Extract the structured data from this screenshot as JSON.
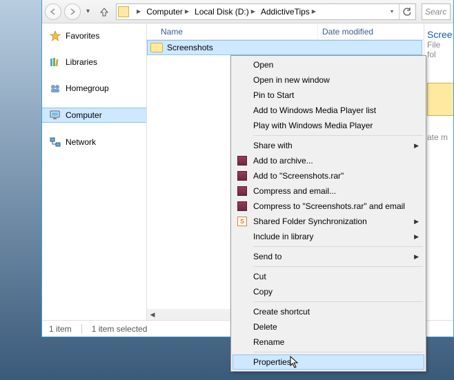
{
  "breadcrumbs": [
    "Computer",
    "Local Disk (D:)",
    "AddictiveTips"
  ],
  "search_placeholder": "Searc",
  "sidebar": {
    "items": [
      {
        "label": "Favorites"
      },
      {
        "label": "Libraries"
      },
      {
        "label": "Homegroup"
      },
      {
        "label": "Computer"
      },
      {
        "label": "Network"
      }
    ]
  },
  "columns": {
    "name": "Name",
    "date": "Date modified"
  },
  "file": {
    "name": "Screenshots"
  },
  "preview": {
    "title": "Scree",
    "type": "File fol",
    "date_prefix": "ate m"
  },
  "status": {
    "count": "1 item",
    "selected": "1 item selected"
  },
  "context": {
    "groups": [
      [
        {
          "label": "Open"
        },
        {
          "label": "Open in new window"
        },
        {
          "label": "Pin to Start"
        },
        {
          "label": "Add to Windows Media Player list"
        },
        {
          "label": "Play with Windows Media Player"
        }
      ],
      [
        {
          "label": "Share with",
          "submenu": true
        },
        {
          "label": "Add to archive...",
          "icon": "rar"
        },
        {
          "label": "Add to \"Screenshots.rar\"",
          "icon": "rar"
        },
        {
          "label": "Compress and email...",
          "icon": "rar"
        },
        {
          "label": "Compress to \"Screenshots.rar\" and email",
          "icon": "rar"
        },
        {
          "label": "Shared Folder Synchronization",
          "icon": "sf",
          "submenu": true
        },
        {
          "label": "Include in library",
          "submenu": true
        }
      ],
      [
        {
          "label": "Send to",
          "submenu": true
        }
      ],
      [
        {
          "label": "Cut"
        },
        {
          "label": "Copy"
        }
      ],
      [
        {
          "label": "Create shortcut"
        },
        {
          "label": "Delete"
        },
        {
          "label": "Rename"
        }
      ],
      [
        {
          "label": "Properties",
          "highlight": true
        }
      ]
    ]
  }
}
